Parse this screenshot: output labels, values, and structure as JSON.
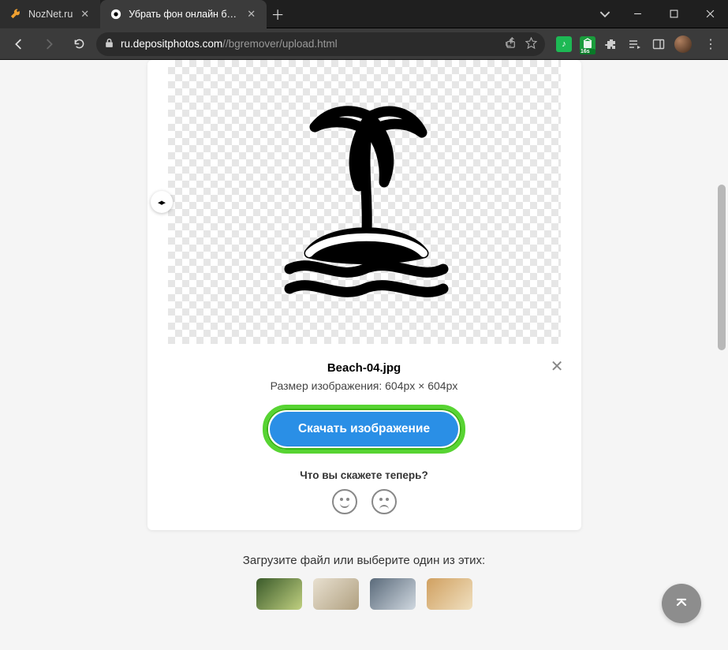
{
  "tabs": [
    {
      "label": "NozNet.ru",
      "active": false
    },
    {
      "label": "Убрать фон онлайн бесплатно",
      "active": true
    }
  ],
  "url": {
    "host": "ru.depositphotos.com",
    "path": "/bgremover/upload.html"
  },
  "page": {
    "filename": "Beach-04.jpg",
    "dimensions": "Размер изображения: 604px × 604px",
    "download_label": "Скачать изображение",
    "feedback_question": "Что вы скажете теперь?",
    "upload_prompt": "Загрузите файл или выберите один из этих:"
  },
  "ext_badge": "16s"
}
